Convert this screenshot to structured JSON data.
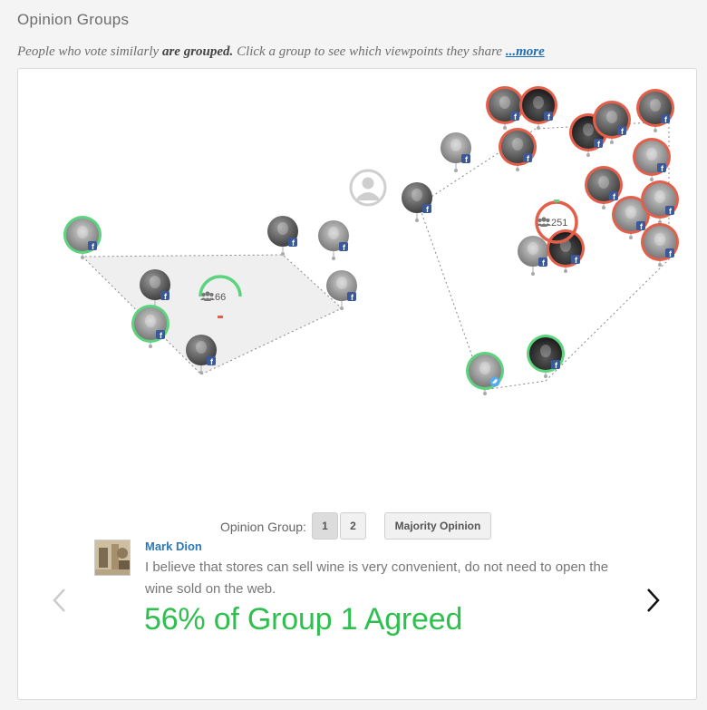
{
  "header": {
    "title": "Opinion Groups",
    "subtitle_pre": "People who vote similarly ",
    "subtitle_bold": "are grouped.",
    "subtitle_post": " Click a group to see which viewpoints they share ",
    "more_link": "...more"
  },
  "groups": [
    {
      "count": "66",
      "color": "#5cd37d",
      "dash_color": "#e35f4a"
    },
    {
      "count": "251",
      "color": "#e35f4a",
      "dash_color": "#5cd37d"
    }
  ],
  "controls": {
    "label": "Opinion Group:",
    "group_buttons": [
      "1",
      "2"
    ],
    "majority_button": "Majority Opinion"
  },
  "comment": {
    "author": "Mark Dion",
    "text": "I believe that stores can sell wine is very convenient, do not need to open the wine sold on the web.",
    "result": "56% of Group 1 Agreed"
  },
  "colors": {
    "agree": "#2fbf4f",
    "group1": "#5cd37d",
    "group2": "#e35f4a",
    "facebook": "#3b5998",
    "twitter": "#55acee",
    "link": "#1c6fb5"
  },
  "icons": [
    "facebook-icon",
    "twitter-icon",
    "user-group-icon",
    "anonymous-user-icon",
    "chevron-left-icon",
    "chevron-right-icon"
  ]
}
